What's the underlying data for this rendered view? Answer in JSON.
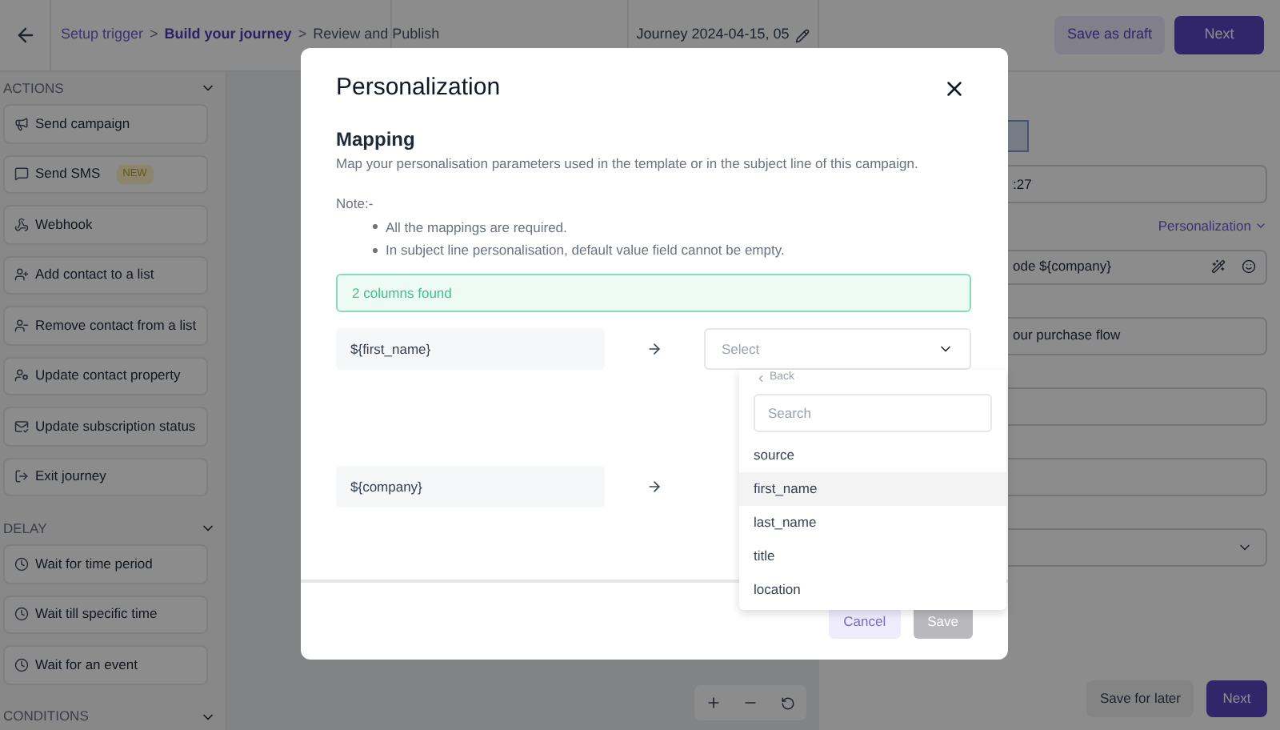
{
  "top_bar": {
    "breadcrumbs": [
      {
        "label": "Setup trigger",
        "selected": false
      },
      {
        "label": "Build your journey",
        "selected": true
      },
      {
        "label": "Review and Publish",
        "selected": false
      }
    ],
    "separators": [
      ">",
      ">"
    ],
    "journey_name": "Journey 2024-04-15, 05",
    "buttons": [
      "Save as draft",
      "Next"
    ]
  },
  "sidebar": {
    "sections": [
      {
        "title": "ACTIONS",
        "items": [
          {
            "label": "Send campaign"
          },
          {
            "label": "Send SMS",
            "badge": "NEW"
          },
          {
            "label": "Webhook"
          },
          {
            "label": "Add contact to a list"
          },
          {
            "label": "Remove contact from a list"
          },
          {
            "label": "Update contact property"
          },
          {
            "label": "Update subscription status"
          },
          {
            "label": "Exit journey"
          }
        ]
      },
      {
        "title": "DELAY",
        "items": [
          {
            "label": "Wait for time period"
          },
          {
            "label": "Wait till specific time"
          },
          {
            "label": "Wait for an event"
          }
        ]
      },
      {
        "title": "CONDITIONS"
      }
    ]
  },
  "right_panel": {
    "fields": [
      {
        "kind": "input",
        "value": ":27"
      },
      {
        "kind": "link",
        "value": "Personalization"
      },
      {
        "kind": "editor",
        "value": "ode ${company}"
      },
      {
        "kind": "input",
        "value": "our purchase flow"
      },
      {
        "kind": "input"
      },
      {
        "kind": "input"
      },
      {
        "kind": "select"
      }
    ],
    "buttons": [
      "Save for later",
      "Next"
    ]
  },
  "modal": {
    "title": "Personalization",
    "section_title": "Mapping",
    "description": "Map your personalisation parameters used in the template or in the subject line of this campaign.",
    "note_title": "Note:-",
    "notes": [
      "All the mappings are required.",
      "In subject line personalisation, default value field cannot be empty."
    ],
    "status": "2 columns found",
    "mappings": [
      {
        "parameter": "${first_name}",
        "select_placeholder": "Select",
        "open": true
      },
      {
        "parameter": "${company}",
        "open": false
      }
    ],
    "dropdown": {
      "back": "Back",
      "search_placeholder": "Search",
      "options": [
        {
          "label": "source",
          "selected": false
        },
        {
          "label": "first_name",
          "selected": true
        },
        {
          "label": "last_name",
          "selected": false
        },
        {
          "label": "title",
          "selected": false
        },
        {
          "label": "location",
          "selected": false
        }
      ]
    },
    "buttons": [
      "Cancel",
      "Save"
    ]
  }
}
